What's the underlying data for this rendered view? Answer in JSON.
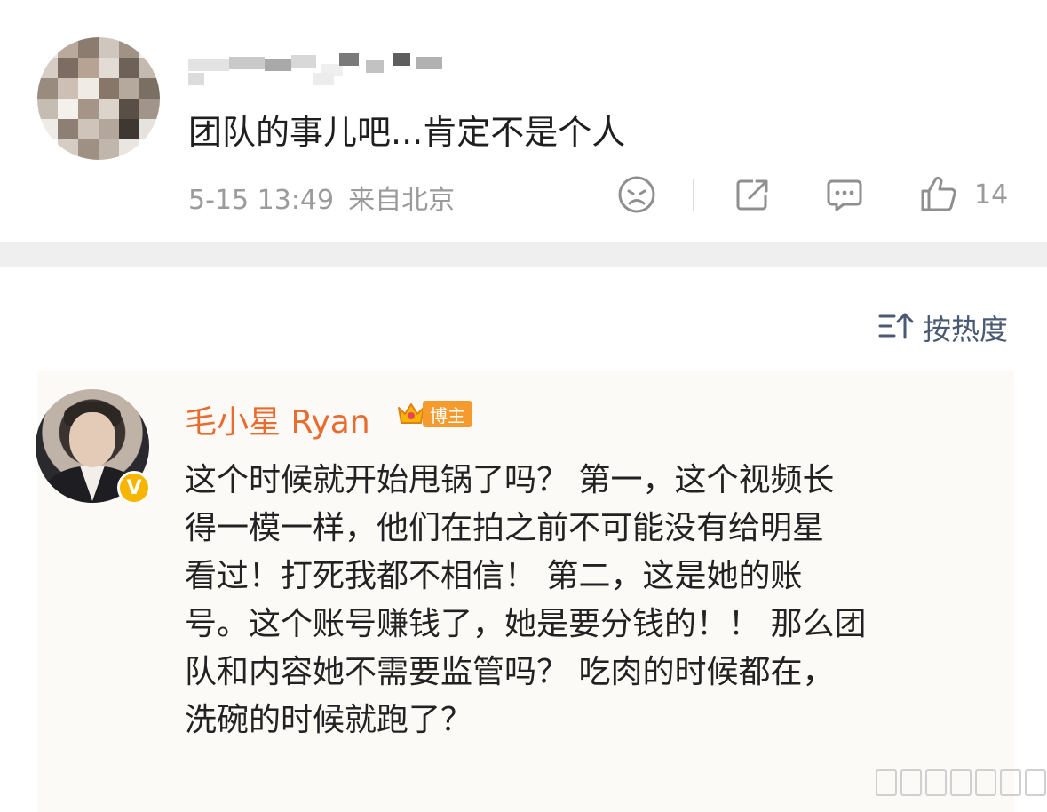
{
  "comment": {
    "text": "团队的事儿吧...肯定不是个人",
    "time": "5-15 13:49",
    "location": "来自北京",
    "like_count": "14"
  },
  "sort": {
    "label": "按热度"
  },
  "reply": {
    "author": "毛小星 Ryan",
    "badge": "博主",
    "lines": [
      "这个时候就开始甩锅了吗？ 第一，这个视频长",
      "得一模一样，他们在拍之前不可能没有给明星",
      "看过！打死我都不相信！ 第二，这是她的账",
      "号。这个账号赚钱了，她是要分钱的！！ 那么团",
      "队和内容她不需要监管吗？ 吃肉的时候都在，",
      "洗碗的时候就跑了？"
    ]
  },
  "colors": {
    "author_name": "#e86b2f",
    "badge_bg": "#f59a2c",
    "meta_gray": "#9b9b9b",
    "sort_blue": "#4a5a74",
    "verified": "#f7b500"
  },
  "icons": [
    "sad-face-icon",
    "share-icon",
    "comment-icon",
    "thumbs-up-icon",
    "sort-icon",
    "crown-icon",
    "verified-v-icon"
  ]
}
